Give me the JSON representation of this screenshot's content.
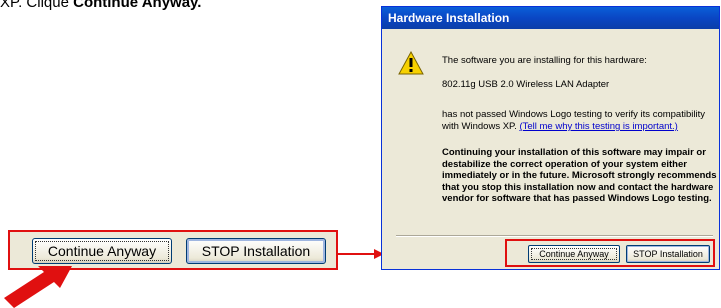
{
  "instruction": {
    "prefix": "XP. Clique ",
    "bold": "Continue Anyway."
  },
  "zoomed": {
    "continue_label": "Continue Anyway",
    "stop_label": "STOP Installation"
  },
  "dialog": {
    "title": "Hardware Installation",
    "line1": "The software you are installing for this hardware:",
    "device": "802.11g USB 2.0 Wireless LAN Adapter",
    "line3a": "has not passed Windows Logo testing to verify its compatibility with Windows XP. ",
    "link": "(Tell me why this testing is important.)",
    "warning": "Continuing your installation of this software may impair or destabilize the correct operation of your system either immediately or in the future. Microsoft strongly recommends that you stop this installation now and contact the hardware vendor for software that has passed Windows Logo testing.",
    "continue_label": "Continue Anyway",
    "stop_label": "STOP Installation"
  },
  "colors": {
    "highlight": "#e01010",
    "title_bar": "#0a46c4",
    "dialog_bg": "#ece9d8"
  },
  "icons": [
    "warning-icon",
    "red-arrow-icon",
    "connector-arrow-icon"
  ]
}
